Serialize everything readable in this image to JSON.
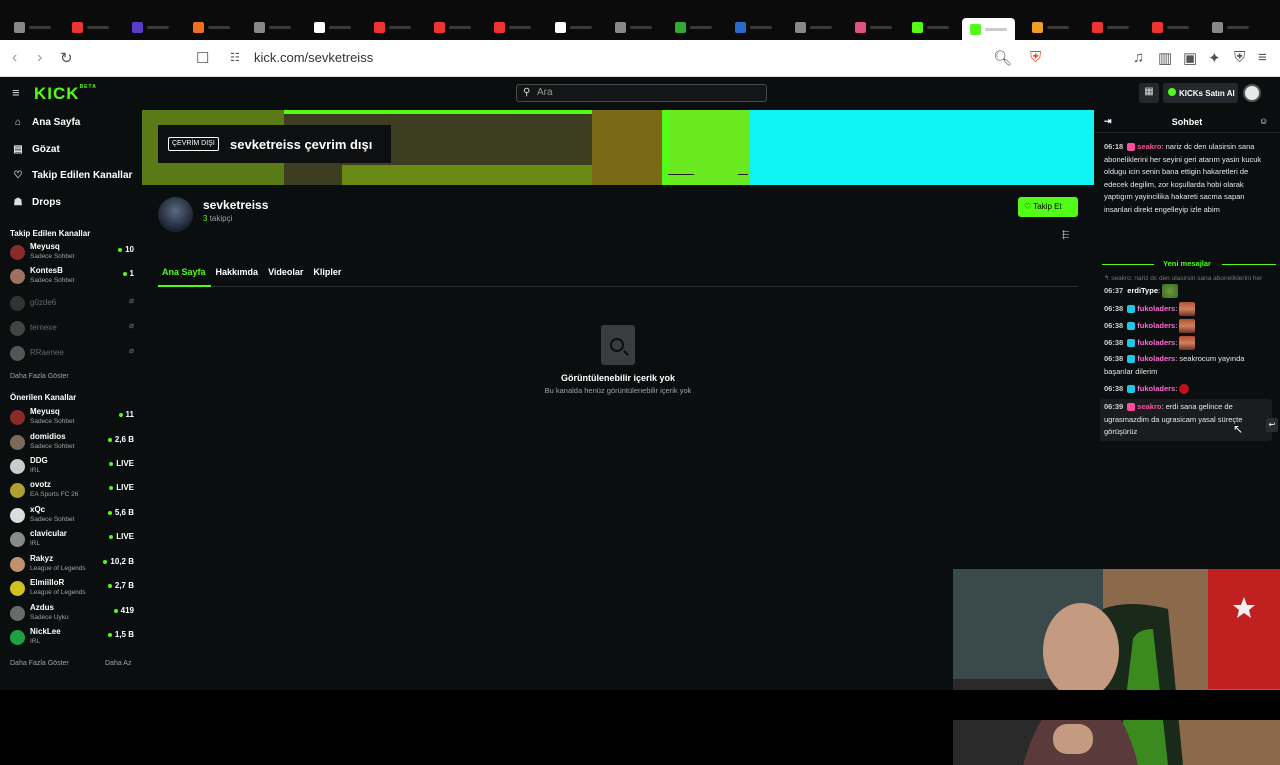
{
  "browser": {
    "url": "kick.com/sevketreiss"
  },
  "topnav": {
    "logo": "KICK",
    "logo_sup": "BETA",
    "search_placeholder": "Ara",
    "buy_label": "KICKs Satın Al"
  },
  "sidebar": {
    "nav": [
      {
        "label": "Ana Sayfa",
        "icon": "home-icon"
      },
      {
        "label": "Gözat",
        "icon": "browse-icon"
      },
      {
        "label": "Takip Edilen Kanallar",
        "icon": "heart-icon"
      },
      {
        "label": "Drops",
        "icon": "gift-icon"
      }
    ],
    "followed_header": "Takip Edilen Kanallar",
    "followed": [
      {
        "name": "Meyusq",
        "category": "Sadece Sohbet",
        "viewers": "10",
        "live": true,
        "color": "#8a2a2a"
      },
      {
        "name": "KontesB",
        "category": "Sadece Sohbet",
        "viewers": "1",
        "live": true,
        "color": "#a07060"
      },
      {
        "name": "g0zde6",
        "category": "",
        "viewers": "",
        "live": false,
        "color": "#333"
      },
      {
        "name": "ternexe",
        "category": "",
        "viewers": "",
        "live": false,
        "color": "#444"
      },
      {
        "name": "RRaenee",
        "category": "",
        "viewers": "",
        "live": false,
        "color": "#555"
      }
    ],
    "followed_more": "Daha Fazla Göster",
    "recommended_header": "Önerilen Kanallar",
    "recommended": [
      {
        "name": "Meyusq",
        "category": "Sadece Sohbet",
        "viewers": "11",
        "color": "#8a2a2a"
      },
      {
        "name": "domidios",
        "category": "Sadece Sohbet",
        "viewers": "2,6 B",
        "color": "#7a6a5a"
      },
      {
        "name": "DDG",
        "category": "IRL",
        "viewers": "LIVE",
        "color": "#ccc"
      },
      {
        "name": "ovotz",
        "category": "EA Sports FC 26",
        "viewers": "LIVE",
        "color": "#b0a030"
      },
      {
        "name": "xQc",
        "category": "Sadece Sohbet",
        "viewers": "5,6 B",
        "color": "#ddd"
      },
      {
        "name": "clavicular",
        "category": "IRL",
        "viewers": "LIVE",
        "color": "#8a8a8a"
      },
      {
        "name": "Rakyz",
        "category": "League of Legends",
        "viewers": "10,2 B",
        "color": "#c09070"
      },
      {
        "name": "ElmiilloR",
        "category": "League of Legends",
        "viewers": "2,7 B",
        "color": "#d0c020"
      },
      {
        "name": "Azdus",
        "category": "Sadece Uyku",
        "viewers": "419",
        "color": "#6a6a6a"
      },
      {
        "name": "NickLee",
        "category": "IRL",
        "viewers": "1,5 B",
        "color": "#20a040"
      }
    ],
    "rec_more": "Daha Fazla Göster",
    "rec_less": "Daha Az"
  },
  "channel": {
    "offline_tag": "ÇEVRİM DIŞI",
    "offline_title": "sevketreiss çevrim dışı",
    "name": "sevketreiss",
    "followers_count": "3",
    "followers_label": "takipçi",
    "follow_label": "Takip Et",
    "tabs": [
      "Ana Sayfa",
      "Hakkımda",
      "Videolar",
      "Klipler"
    ],
    "empty_title": "Görüntülenebilir içerik yok",
    "empty_sub": "Bu kanalda henüz görüntülenebilir içerik yok"
  },
  "chat": {
    "title": "Sohbet",
    "first_msg": {
      "time": "06:18",
      "user": "seakro",
      "text": "nariz dc den ulasirsin sana aboneliklerini her seyini geri atarım yasin kucuk oldugu icin senin bana ettigin hakaretleri de edecek degilim, zor koşullarda hobi olarak yaptıgım yayincilika hakareti sacma sapan insanlari direkt engelleyip izle abim"
    },
    "new_messages": "Yeni mesajlar",
    "reply_preview": "seakro: nariz dc den ulasirsin sana aboneliklerini her",
    "messages": [
      {
        "time": "06:37",
        "user": "erdiType",
        "text": ""
      },
      {
        "time": "06:38",
        "user": "fukoladers",
        "text": ""
      },
      {
        "time": "06:38",
        "user": "fukoladers",
        "text": ""
      },
      {
        "time": "06:38",
        "user": "fukoladers",
        "text": ""
      },
      {
        "time": "06:38",
        "user": "fukoladers",
        "text": "seakrocum yayında başarılar dilerim"
      },
      {
        "time": "06:38",
        "user": "fukoladers",
        "text": ""
      },
      {
        "time": "06:39",
        "user": "seakro",
        "text": "erdi sana gelince de ugrasmazdim da ugrasicam yasal süreçte görüşürüz"
      }
    ]
  }
}
